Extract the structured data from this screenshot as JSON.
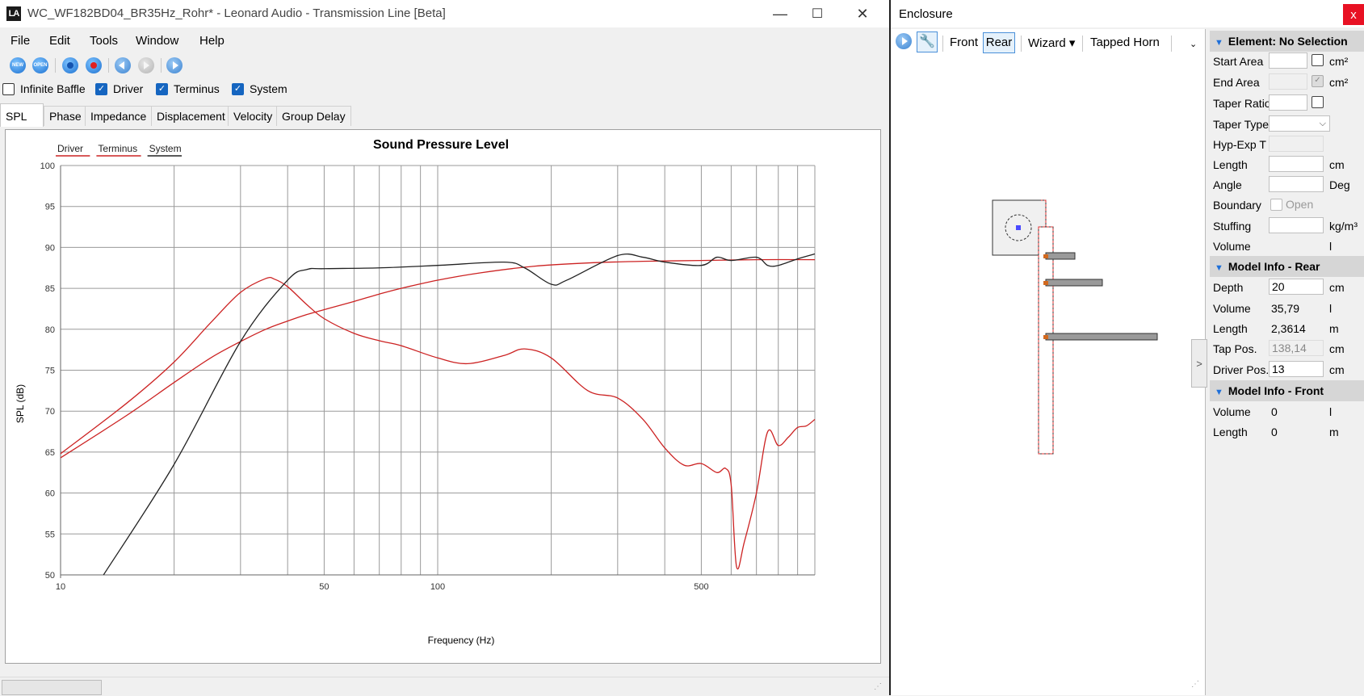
{
  "main_window": {
    "title": "WC_WF182BD04_BR35Hz_Rohr* - Leonard Audio - Transmission Line [Beta]",
    "logo_text": "LA",
    "controls": {
      "minimize": "—",
      "maximize": "☐",
      "close": "✕"
    }
  },
  "menu": [
    "File",
    "Edit",
    "Tools",
    "Window",
    "Help"
  ],
  "toolbar": {
    "buttons": [
      "new-icon",
      "open-icon",
      "record-blue-icon",
      "record-red-icon",
      "step-back-icon",
      "step-disabled-icon",
      "play-icon"
    ],
    "new_label": "NEW",
    "open_label": "OPEN"
  },
  "checkboxes": [
    {
      "label": "Infinite Baffle",
      "checked": false
    },
    {
      "label": "Driver",
      "checked": true
    },
    {
      "label": "Terminus",
      "checked": true
    },
    {
      "label": "System",
      "checked": true
    }
  ],
  "tabs": [
    "SPL",
    "Phase",
    "Impedance",
    "Displacement",
    "Velocity",
    "Group Delay"
  ],
  "active_tab": "SPL",
  "chart_data": {
    "type": "line",
    "title": "Sound Pressure Level",
    "xlabel": "Frequency (Hz)",
    "ylabel": "SPL (dB)",
    "x_scale": "log",
    "xlim": [
      10,
      1000
    ],
    "ylim": [
      50,
      100
    ],
    "x_tick_labels": [
      "10",
      "50",
      "100",
      "500"
    ],
    "y_tick_labels": [
      "100",
      "95",
      "90",
      "85",
      "80",
      "75",
      "70",
      "65",
      "60",
      "55",
      "50"
    ],
    "grid": true,
    "legend_position": "top-left",
    "series": [
      {
        "name": "Driver",
        "color": "#cc2222",
        "x": [
          10,
          15,
          20,
          25,
          30,
          35,
          40,
          45,
          50,
          60,
          70,
          80,
          100,
          130,
          180,
          250,
          350,
          500,
          700,
          1000
        ],
        "y": [
          64.3,
          69.5,
          73.5,
          76.5,
          78.5,
          80.0,
          81.0,
          81.8,
          82.4,
          83.4,
          84.3,
          85.0,
          86.0,
          86.9,
          87.7,
          88.1,
          88.3,
          88.4,
          88.5,
          88.5
        ]
      },
      {
        "name": "Terminus",
        "color": "#cc2222",
        "x": [
          10,
          15,
          20,
          25,
          30,
          35,
          37,
          40,
          45,
          50,
          60,
          70,
          80,
          100,
          120,
          150,
          170,
          200,
          250,
          300,
          350,
          400,
          450,
          500,
          550,
          580,
          600,
          620,
          650,
          700,
          750,
          800,
          850,
          900,
          950,
          1000
        ],
        "y": [
          64.8,
          71.0,
          76.0,
          80.8,
          84.5,
          86.2,
          86.1,
          85.2,
          83.0,
          81.3,
          79.5,
          78.6,
          78.0,
          76.5,
          75.8,
          76.8,
          77.6,
          76.5,
          72.5,
          71.6,
          69.0,
          65.5,
          63.4,
          63.6,
          62.5,
          63.0,
          61.0,
          51.0,
          54.0,
          60.0,
          67.5,
          65.8,
          66.8,
          68.0,
          68.2,
          69.0
        ]
      },
      {
        "name": "System",
        "color": "#222222",
        "x": [
          13,
          20,
          30,
          40,
          45,
          50,
          70,
          100,
          150,
          170,
          200,
          220,
          300,
          350,
          400,
          500,
          550,
          600,
          700,
          750,
          800,
          900,
          1000
        ],
        "y": [
          50.0,
          63.5,
          78.5,
          86.0,
          87.3,
          87.4,
          87.5,
          87.8,
          88.2,
          87.5,
          85.5,
          86.0,
          89.0,
          88.8,
          88.2,
          87.8,
          88.8,
          88.4,
          88.8,
          87.8,
          87.8,
          88.6,
          89.2
        ]
      }
    ]
  },
  "enclosure_window": {
    "title": "Enclosure",
    "close": "x",
    "toolbar": {
      "front": "Front",
      "rear": "Rear",
      "wizard": "Wizard ▾",
      "tapped_horn": "Tapped Horn",
      "overflow": "⌄"
    },
    "collapse_glyph": ">"
  },
  "properties": {
    "element_section": {
      "title": "Element: No Selection",
      "rows": [
        {
          "label": "Start Area",
          "value": "",
          "unit": "cm²",
          "checkbox": true
        },
        {
          "label": "End Area",
          "value": "",
          "unit": "cm²",
          "checkbox": true,
          "disabled": true
        },
        {
          "label": "Taper Ratio",
          "value": "",
          "unit": "",
          "checkbox": true
        },
        {
          "label": "Taper Type",
          "value": "",
          "unit": "",
          "dropdown": true
        },
        {
          "label": "Hyp-Exp T",
          "value": "",
          "unit": "",
          "disabled": true
        },
        {
          "label": "Length",
          "value": "",
          "unit": "cm"
        },
        {
          "label": "Angle",
          "value": "",
          "unit": "Deg"
        },
        {
          "label": "Boundary",
          "value": "Open",
          "unit": "",
          "checkbox_left": true
        },
        {
          "label": "Stuffing",
          "value": "",
          "unit": "kg/m³"
        },
        {
          "label": "Volume",
          "value": "",
          "unit": "l",
          "plain": true
        }
      ]
    },
    "rear_section": {
      "title": "Model Info - Rear",
      "rows": [
        {
          "label": "Depth",
          "value": "20",
          "unit": "cm",
          "input": true
        },
        {
          "label": "Volume",
          "value": "35,79",
          "unit": "l"
        },
        {
          "label": "Length",
          "value": "2,3614",
          "unit": "m"
        },
        {
          "label": "Tap Pos.",
          "value": "138,14",
          "unit": "cm",
          "input": true,
          "disabled": true
        },
        {
          "label": "Driver Pos.",
          "value": "13",
          "unit": "cm",
          "input": true
        }
      ]
    },
    "front_section": {
      "title": "Model Info - Front",
      "rows": [
        {
          "label": "Volume",
          "value": "0",
          "unit": "l"
        },
        {
          "label": "Length",
          "value": "0",
          "unit": "m"
        }
      ]
    }
  },
  "colors": {
    "accent": "#1565c0",
    "driver_line": "#cc2222",
    "terminus_line": "#cc2222",
    "system_line": "#222222",
    "close_red": "#e81123"
  }
}
